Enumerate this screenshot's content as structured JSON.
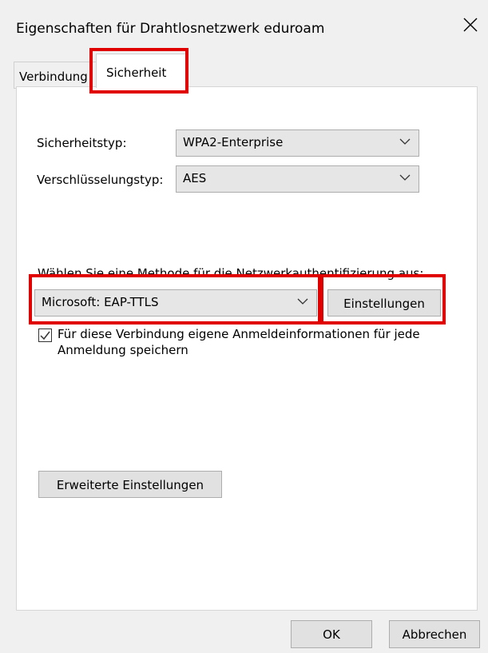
{
  "window": {
    "title": "Eigenschaften für Drahtlosnetzwerk eduroam",
    "close_icon": "close-icon"
  },
  "tabs": [
    {
      "label": "Verbindung",
      "active": false
    },
    {
      "label": "Sicherheit",
      "active": true
    }
  ],
  "security": {
    "type_label": "Sicherheitstyp:",
    "type_value": "WPA2-Enterprise",
    "encryption_label": "Verschlüsselungstyp:",
    "encryption_value": "AES",
    "method_label": "Wählen Sie eine Methode für die Netzwerkauthentifizierung aus:",
    "method_value": "Microsoft: EAP-TTLS",
    "settings_button": "Einstellungen",
    "remember_checkbox_label": "Für diese Verbindung eigene Anmeldeinformationen für jede Anmeldung speichern",
    "remember_checked": true,
    "advanced_button": "Erweiterte Einstellungen"
  },
  "footer": {
    "ok_button": "OK",
    "cancel_button": "Abbrechen"
  },
  "colors": {
    "highlight": "#e00000",
    "window_bg": "#f0f0f0",
    "panel_bg": "#ffffff"
  }
}
